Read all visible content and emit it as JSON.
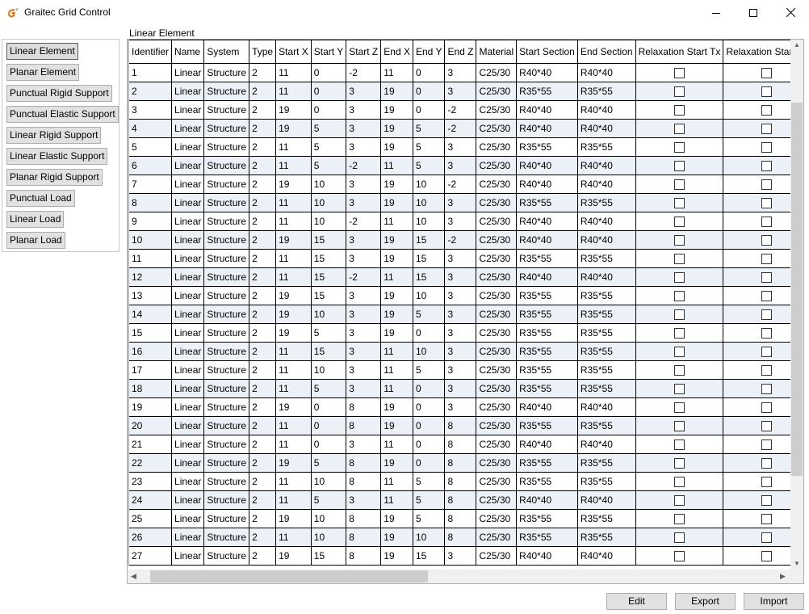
{
  "window": {
    "title": "Graitec Grid Control",
    "icon": "graitec-logo-icon",
    "buttons": [
      "minimize-icon",
      "maximize-icon",
      "close-icon"
    ]
  },
  "sidebar": {
    "items": [
      {
        "label": "Linear Element",
        "active": true
      },
      {
        "label": "Planar Element",
        "active": false
      },
      {
        "label": "Punctual Rigid Support",
        "active": false
      },
      {
        "label": "Punctual Elastic Support",
        "active": false
      },
      {
        "label": "Linear Rigid Support",
        "active": false
      },
      {
        "label": "Linear Elastic Support",
        "active": false
      },
      {
        "label": "Planar Rigid Support",
        "active": false
      },
      {
        "label": "Punctual Load",
        "active": false
      },
      {
        "label": "Linear Load",
        "active": false
      },
      {
        "label": "Planar Load",
        "active": false
      }
    ]
  },
  "grid": {
    "title": "Linear Element",
    "columns": [
      "Identifier",
      "Name",
      "System",
      "Type",
      "Start X",
      "Start Y",
      "Start Z",
      "End X",
      "End Y",
      "End Z",
      "Material",
      "Start Section",
      "End Section",
      "Relaxation Start Tx",
      "Relaxation Start Ty"
    ],
    "rows": [
      [
        "1",
        "Linear",
        "Structure",
        "2",
        "11",
        "0",
        "-2",
        "11",
        "0",
        "3",
        "C25/30",
        "R40*40",
        "R40*40",
        false,
        false
      ],
      [
        "2",
        "Linear",
        "Structure",
        "2",
        "11",
        "0",
        "3",
        "19",
        "0",
        "3",
        "C25/30",
        "R35*55",
        "R35*55",
        false,
        false
      ],
      [
        "3",
        "Linear",
        "Structure",
        "2",
        "19",
        "0",
        "3",
        "19",
        "0",
        "-2",
        "C25/30",
        "R40*40",
        "R40*40",
        false,
        false
      ],
      [
        "4",
        "Linear",
        "Structure",
        "2",
        "19",
        "5",
        "3",
        "19",
        "5",
        "-2",
        "C25/30",
        "R40*40",
        "R40*40",
        false,
        false
      ],
      [
        "5",
        "Linear",
        "Structure",
        "2",
        "11",
        "5",
        "3",
        "19",
        "5",
        "3",
        "C25/30",
        "R35*55",
        "R35*55",
        false,
        false
      ],
      [
        "6",
        "Linear",
        "Structure",
        "2",
        "11",
        "5",
        "-2",
        "11",
        "5",
        "3",
        "C25/30",
        "R40*40",
        "R40*40",
        false,
        false
      ],
      [
        "7",
        "Linear",
        "Structure",
        "2",
        "19",
        "10",
        "3",
        "19",
        "10",
        "-2",
        "C25/30",
        "R40*40",
        "R40*40",
        false,
        false
      ],
      [
        "8",
        "Linear",
        "Structure",
        "2",
        "11",
        "10",
        "3",
        "19",
        "10",
        "3",
        "C25/30",
        "R35*55",
        "R35*55",
        false,
        false
      ],
      [
        "9",
        "Linear",
        "Structure",
        "2",
        "11",
        "10",
        "-2",
        "11",
        "10",
        "3",
        "C25/30",
        "R40*40",
        "R40*40",
        false,
        false
      ],
      [
        "10",
        "Linear",
        "Structure",
        "2",
        "19",
        "15",
        "3",
        "19",
        "15",
        "-2",
        "C25/30",
        "R40*40",
        "R40*40",
        false,
        false
      ],
      [
        "11",
        "Linear",
        "Structure",
        "2",
        "11",
        "15",
        "3",
        "19",
        "15",
        "3",
        "C25/30",
        "R35*55",
        "R35*55",
        false,
        false
      ],
      [
        "12",
        "Linear",
        "Structure",
        "2",
        "11",
        "15",
        "-2",
        "11",
        "15",
        "3",
        "C25/30",
        "R40*40",
        "R40*40",
        false,
        false
      ],
      [
        "13",
        "Linear",
        "Structure",
        "2",
        "19",
        "15",
        "3",
        "19",
        "10",
        "3",
        "C25/30",
        "R35*55",
        "R35*55",
        false,
        false
      ],
      [
        "14",
        "Linear",
        "Structure",
        "2",
        "19",
        "10",
        "3",
        "19",
        "5",
        "3",
        "C25/30",
        "R35*55",
        "R35*55",
        false,
        false
      ],
      [
        "15",
        "Linear",
        "Structure",
        "2",
        "19",
        "5",
        "3",
        "19",
        "0",
        "3",
        "C25/30",
        "R35*55",
        "R35*55",
        false,
        false
      ],
      [
        "16",
        "Linear",
        "Structure",
        "2",
        "11",
        "15",
        "3",
        "11",
        "10",
        "3",
        "C25/30",
        "R35*55",
        "R35*55",
        false,
        false
      ],
      [
        "17",
        "Linear",
        "Structure",
        "2",
        "11",
        "10",
        "3",
        "11",
        "5",
        "3",
        "C25/30",
        "R35*55",
        "R35*55",
        false,
        false
      ],
      [
        "18",
        "Linear",
        "Structure",
        "2",
        "11",
        "5",
        "3",
        "11",
        "0",
        "3",
        "C25/30",
        "R35*55",
        "R35*55",
        false,
        false
      ],
      [
        "19",
        "Linear",
        "Structure",
        "2",
        "19",
        "0",
        "8",
        "19",
        "0",
        "3",
        "C25/30",
        "R40*40",
        "R40*40",
        false,
        false
      ],
      [
        "20",
        "Linear",
        "Structure",
        "2",
        "11",
        "0",
        "8",
        "19",
        "0",
        "8",
        "C25/30",
        "R35*55",
        "R35*55",
        false,
        false
      ],
      [
        "21",
        "Linear",
        "Structure",
        "2",
        "11",
        "0",
        "3",
        "11",
        "0",
        "8",
        "C25/30",
        "R40*40",
        "R40*40",
        false,
        false
      ],
      [
        "22",
        "Linear",
        "Structure",
        "2",
        "19",
        "5",
        "8",
        "19",
        "0",
        "8",
        "C25/30",
        "R35*55",
        "R35*55",
        false,
        false
      ],
      [
        "23",
        "Linear",
        "Structure",
        "2",
        "11",
        "10",
        "8",
        "11",
        "5",
        "8",
        "C25/30",
        "R35*55",
        "R35*55",
        false,
        false
      ],
      [
        "24",
        "Linear",
        "Structure",
        "2",
        "11",
        "5",
        "3",
        "11",
        "5",
        "8",
        "C25/30",
        "R40*40",
        "R40*40",
        false,
        false
      ],
      [
        "25",
        "Linear",
        "Structure",
        "2",
        "19",
        "10",
        "8",
        "19",
        "5",
        "8",
        "C25/30",
        "R35*55",
        "R35*55",
        false,
        false
      ],
      [
        "26",
        "Linear",
        "Structure",
        "2",
        "11",
        "10",
        "8",
        "19",
        "10",
        "8",
        "C25/30",
        "R35*55",
        "R35*55",
        false,
        false
      ],
      [
        "27",
        "Linear",
        "Structure",
        "2",
        "19",
        "15",
        "8",
        "19",
        "15",
        "3",
        "C25/30",
        "R40*40",
        "R40*40",
        false,
        false
      ]
    ]
  },
  "footer": {
    "edit_label": "Edit",
    "export_label": "Export",
    "import_label": "Import"
  },
  "colors": {
    "alt_row": "#ecf1f8",
    "button_face": "#e1e1e1",
    "icon_accent": "#e07b1a"
  }
}
